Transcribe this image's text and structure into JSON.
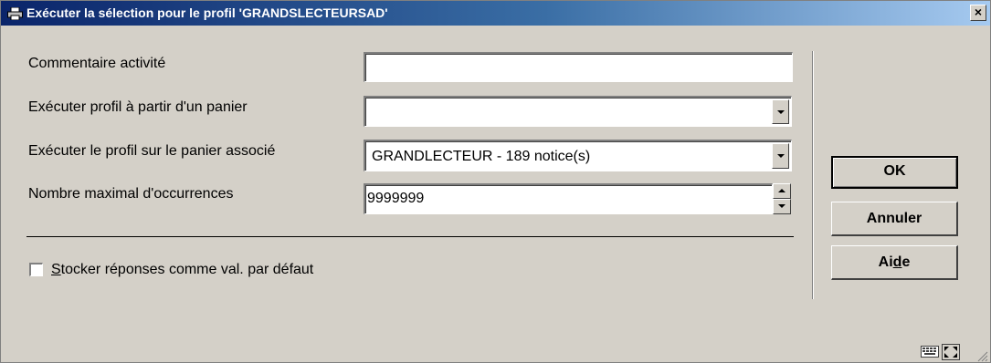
{
  "window": {
    "title": "Exécuter la sélection pour le profil 'GRANDSLECTEURSAD'",
    "close_label": "×"
  },
  "form": {
    "comment": {
      "label": "Commentaire activité",
      "value": ""
    },
    "basket": {
      "label": "Exécuter profil à partir d'un panier",
      "value": ""
    },
    "assoc_basket": {
      "label": "Exécuter le profil sur le panier associé",
      "value": "GRANDLECTEUR - 189 notice(s)"
    },
    "max_occ": {
      "label": "Nombre maximal d'occurrences",
      "value": "9999999"
    },
    "store_defaults": {
      "label_first": "S",
      "label_rest": "tocker réponses comme val. par défaut",
      "checked": false
    }
  },
  "buttons": {
    "ok": "OK",
    "cancel": "Annuler",
    "help_a": "Ai",
    "help_d": "d",
    "help_e": "e"
  },
  "icons": [
    "printer-icon",
    "close-icon",
    "dropdown-arrow-icon",
    "spin-up-icon",
    "spin-down-icon",
    "keyboard-icon",
    "resize-icon",
    "size-grip-icon"
  ]
}
